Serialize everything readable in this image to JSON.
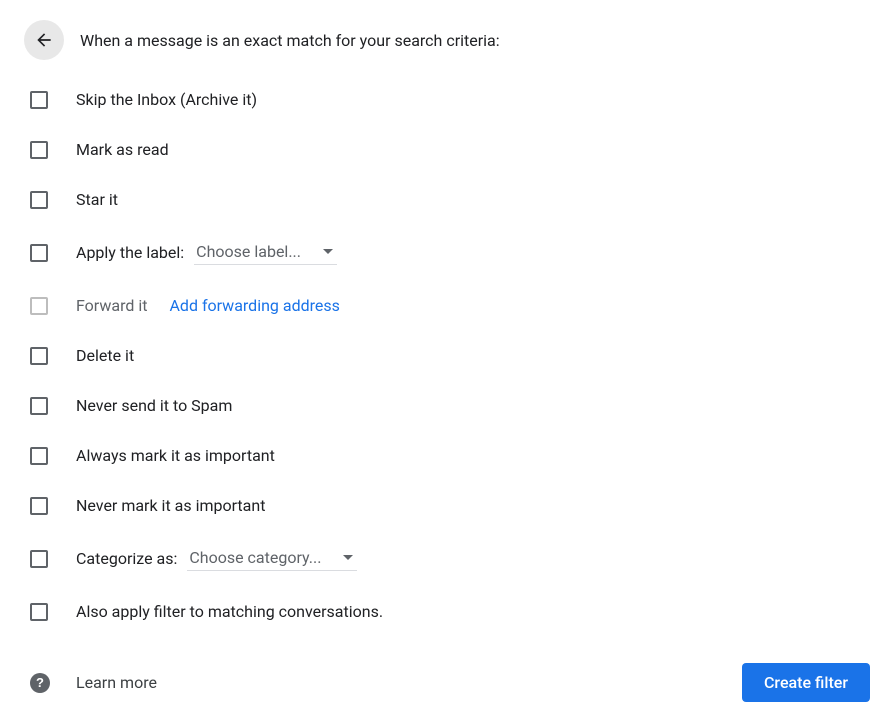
{
  "header": {
    "title": "When a message is an exact match for your search criteria:"
  },
  "options": {
    "skip_inbox": "Skip the Inbox (Archive it)",
    "mark_read": "Mark as read",
    "star_it": "Star it",
    "apply_label": "Apply the label:",
    "apply_label_dropdown": "Choose label...",
    "forward_it": "Forward it",
    "forward_link": "Add forwarding address",
    "delete_it": "Delete it",
    "never_spam": "Never send it to Spam",
    "always_important": "Always mark it as important",
    "never_important": "Never mark it as important",
    "categorize_as": "Categorize as:",
    "categorize_dropdown": "Choose category...",
    "also_apply": "Also apply filter to matching conversations."
  },
  "footer": {
    "learn_more": "Learn more",
    "create_filter": "Create filter",
    "help_glyph": "?"
  }
}
